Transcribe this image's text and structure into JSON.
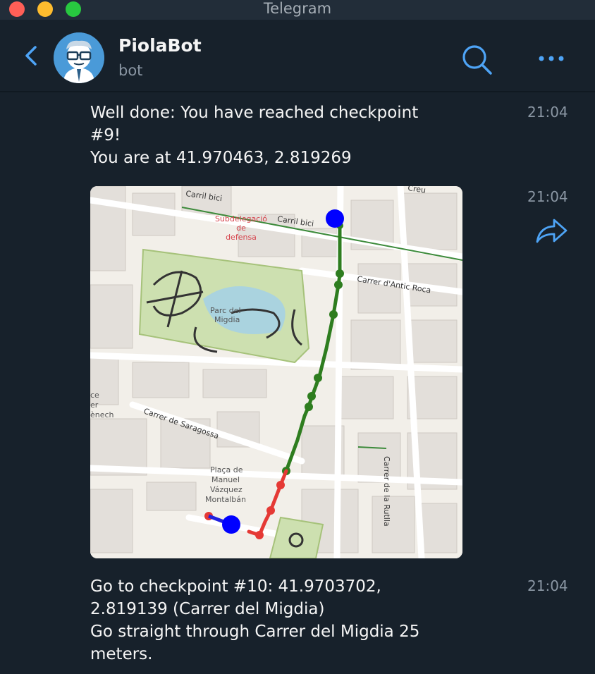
{
  "window": {
    "title": "Telegram"
  },
  "header": {
    "name": "PiolaBot",
    "status": "bot"
  },
  "messages": [
    {
      "text": "Well done: You have reached checkpoint\n#9!\nYou are at 41.970463, 2.819269",
      "time": "21:04"
    },
    {
      "type": "map",
      "time": "21:04"
    },
    {
      "text": "Go to checkpoint #10: 41.9703702,\n2.819139 (Carrer del Migdia)\nGo straight through Carrer del Migdia 25\nmeters.",
      "time": "21:04"
    }
  ],
  "map": {
    "labels": {
      "carril_bici_1": "Carril bici",
      "carril_bici_2": "Carril bici",
      "creu": "Creu",
      "subdelegacio": "Subdelegació",
      "de": "de",
      "defensa": "defensa",
      "antic_roca": "Carrer d'Antic Roca",
      "parc": "Parc del",
      "migdia": "Migdia",
      "saragossa": "Carrer de Saragossa",
      "plaça_1": "Plaça de",
      "plaça_2": "Manuel",
      "plaça_3": "Vázquez",
      "plaça_4": "Montalbán",
      "rutlla": "Carrer de la Rutlla",
      "cut_1": "ce",
      "cut_2": "er",
      "cut_3": "ènech"
    },
    "colors": {
      "route_done": "#2e7d1f",
      "route_next": "#e53935",
      "marker": "#0000ff",
      "route_blue": "#2020e0"
    }
  }
}
